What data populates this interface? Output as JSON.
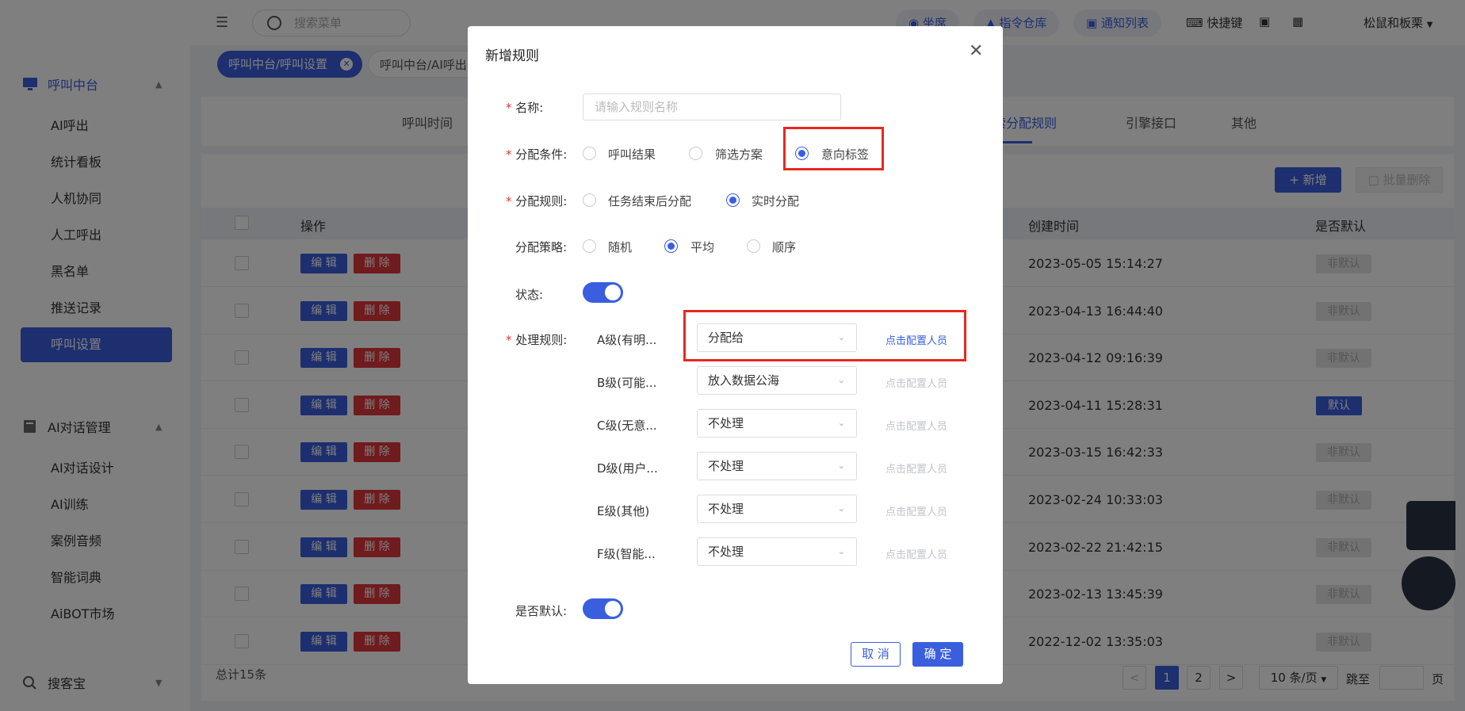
{
  "sidebar": {
    "group1": "呼叫中台",
    "items": [
      "AI呼出",
      "统计看板",
      "人机协同",
      "人工呼出",
      "黑名单",
      "推送记录",
      "呼叫设置"
    ],
    "group2": "AI对话管理",
    "items2": [
      "AI对话设计",
      "AI训练",
      "案例音频",
      "智能词典",
      "AiBOT市场"
    ],
    "group3": "搜客宝"
  },
  "topbar": {
    "search_placeholder": "搜索菜单",
    "seat": "坐席",
    "command": "指令仓库",
    "notify": "通知列表",
    "shortcut": "快捷键",
    "user": "松鼠和板栗"
  },
  "tags": {
    "tag1": "呼叫中台/呼叫设置",
    "tag2": "呼叫中台/AI呼出"
  },
  "tabs": {
    "t1": "呼叫时间",
    "t2": "线索分配规则",
    "t3": "引擎接口",
    "t4": "其他"
  },
  "toolbar": {
    "add": "新增",
    "batch_delete": "批量删除"
  },
  "table": {
    "headers": {
      "op": "操作",
      "created": "创建时间",
      "default": "是否默认"
    },
    "edit": "编 辑",
    "delete": "删 除",
    "rows": [
      {
        "time": "2023-05-05 15:14:27",
        "default": "非默认"
      },
      {
        "time": "2023-04-13 16:44:40",
        "default": "非默认"
      },
      {
        "time": "2023-04-12 09:16:39",
        "default": "非默认"
      },
      {
        "time": "2023-04-11 15:28:31",
        "default": "默认"
      },
      {
        "time": "2023-03-15 16:42:33",
        "default": "非默认"
      },
      {
        "time": "2023-02-24 10:33:03",
        "default": "非默认"
      },
      {
        "time": "2023-02-22 21:42:15",
        "default": "非默认"
      },
      {
        "time": "2023-02-13 13:45:39",
        "default": "非默认"
      },
      {
        "time": "2022-12-02 13:35:03",
        "default": "非默认"
      }
    ],
    "total": "总计15条"
  },
  "pagination": {
    "p1": "1",
    "p2": "2",
    "size": "10 条/页",
    "goto": "跳至",
    "page": "页"
  },
  "modal": {
    "title": "新增规则",
    "name_label": "名称:",
    "name_placeholder": "请输入规则名称",
    "cond_label": "分配条件:",
    "cond_options": [
      "呼叫结果",
      "筛选方案",
      "意向标签"
    ],
    "cond_selected": "意向标签",
    "rule_label": "分配规则:",
    "rule_options": [
      "任务结束后分配",
      "实时分配"
    ],
    "rule_selected": "实时分配",
    "strategy_label": "分配策略:",
    "strategy_options": [
      "随机",
      "平均",
      "顺序"
    ],
    "strategy_selected": "平均",
    "status_label": "状态:",
    "status_on": true,
    "handle_label": "处理规则:",
    "handle_rows": [
      {
        "level": "A级(有明...",
        "action": "分配给",
        "config": "点击配置人员"
      },
      {
        "level": "B级(可能...",
        "action": "放入数据公海",
        "config": "点击配置人员"
      },
      {
        "level": "C级(无意...",
        "action": "不处理",
        "config": "点击配置人员"
      },
      {
        "level": "D级(用户...",
        "action": "不处理",
        "config": "点击配置人员"
      },
      {
        "level": "E级(其他)",
        "action": "不处理",
        "config": "点击配置人员"
      },
      {
        "level": "F级(智能...",
        "action": "不处理",
        "config": "点击配置人员"
      }
    ],
    "default_label": "是否默认:",
    "default_on": true,
    "cancel": "取 消",
    "confirm": "确 定"
  },
  "colors": {
    "accent": "#3a5fde",
    "danger": "#e0363c",
    "highlight": "#e8281f"
  }
}
